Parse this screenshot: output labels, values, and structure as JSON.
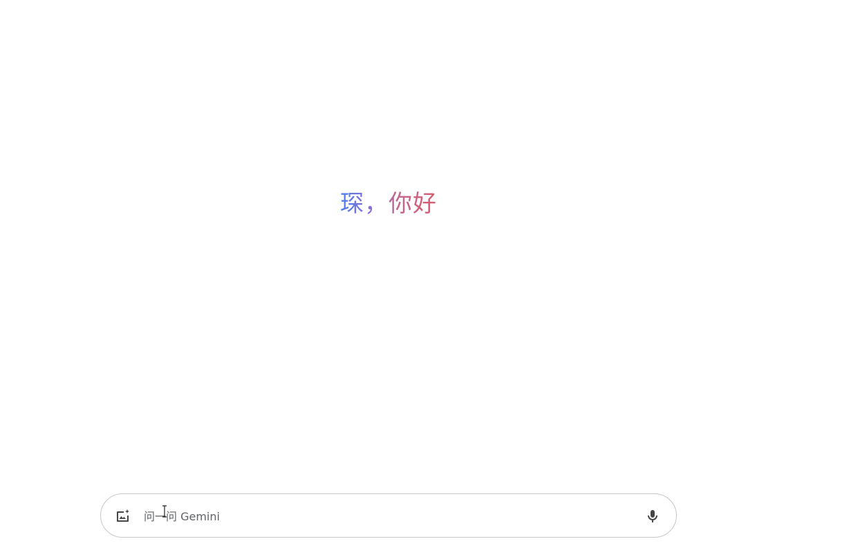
{
  "greeting": {
    "name": "琛",
    "separator": "，",
    "salutation": "你好"
  },
  "prompt": {
    "placeholder": "问一问 Gemini",
    "value": ""
  },
  "icons": {
    "image_upload": "add-image-icon",
    "microphone": "microphone-icon"
  },
  "colors": {
    "gradient_start": "#4a7ff0",
    "gradient_end": "#d95a6a",
    "icon": "#444746",
    "border": "#c4c7c5"
  }
}
